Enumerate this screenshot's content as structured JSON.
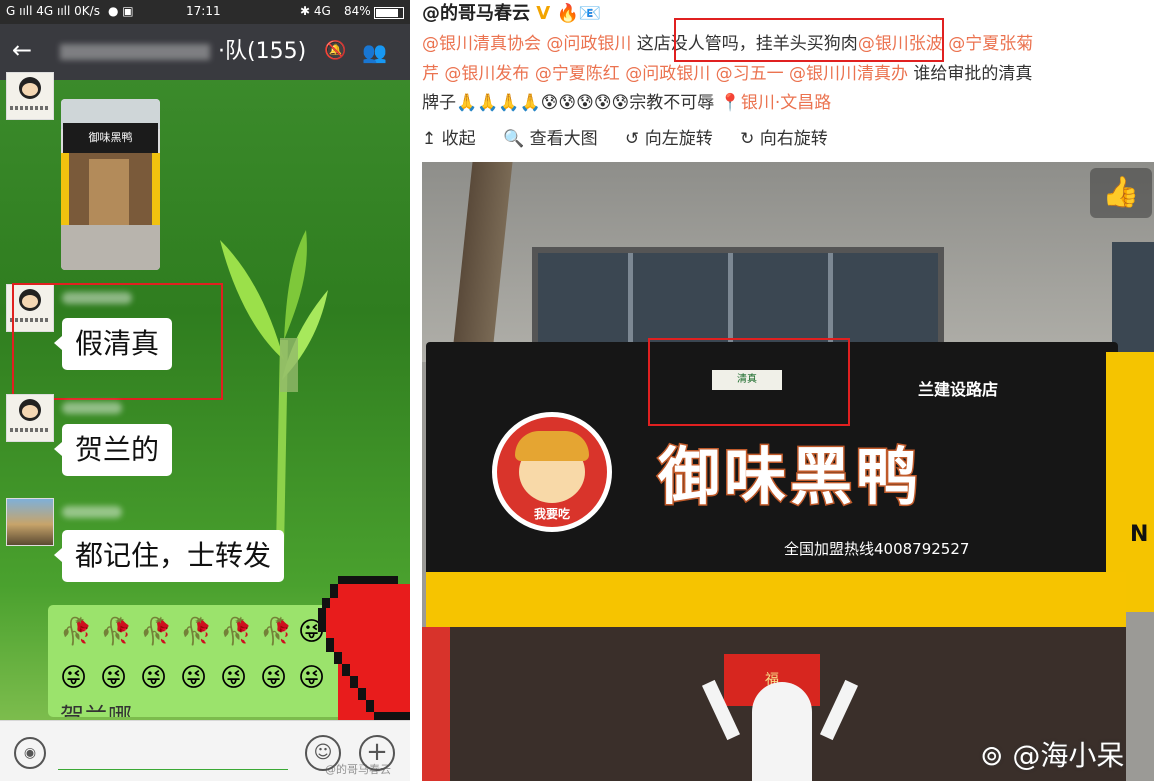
{
  "status_bar": {
    "network_left": "G ııll 4G ııll 0K/s",
    "time": "17:11",
    "battery": "84%"
  },
  "chat": {
    "title": "·队(155)",
    "messages": [
      {
        "type": "image",
        "image_text": "御味黑鸭"
      },
      {
        "type": "text",
        "text": "假清真"
      },
      {
        "type": "text",
        "text": "贺兰的"
      },
      {
        "type": "text",
        "text": "都记住，士转发"
      },
      {
        "type": "emoji",
        "trailing_text": "贺兰哪"
      }
    ],
    "icons": [
      "back-icon",
      "mute-icon",
      "group-members-icon",
      "voice-icon",
      "emoji-icon",
      "plus-icon"
    ],
    "watermark": "@的哥马春云"
  },
  "weibo": {
    "author": "@的哥马春云",
    "lines": [
      {
        "segments": [
          {
            "text": "@银川清真协会",
            "mention": true
          },
          {
            "text": " ",
            "mention": false
          },
          {
            "text": "@问政银川",
            "mention": true
          },
          {
            "text": "  这店没人管吗，挂羊头买狗肉",
            "mention": false
          },
          {
            "text": "@银川张波",
            "mention": true
          },
          {
            "text": " ",
            "mention": false
          },
          {
            "text": "@宁夏张菊",
            "mention": true
          }
        ]
      },
      {
        "segments": [
          {
            "text": "芹 ",
            "mention": true
          },
          {
            "text": "@银川发布",
            "mention": true
          },
          {
            "text": " ",
            "mention": false
          },
          {
            "text": "@宁夏陈红",
            "mention": true
          },
          {
            "text": " ",
            "mention": false
          },
          {
            "text": "@问政银川",
            "mention": true
          },
          {
            "text": " ",
            "mention": false
          },
          {
            "text": "@习五一",
            "mention": true
          },
          {
            "text": " ",
            "mention": false
          },
          {
            "text": "@银川川清真办",
            "mention": true
          },
          {
            "text": " 谁给审批的清真",
            "mention": false
          }
        ]
      },
      {
        "segments": [
          {
            "text": "牌子🙏🙏🙏🙏😰😰😰😰😰宗教不可辱",
            "mention": false
          },
          {
            "text": " 📍银川·文昌路",
            "mention": true
          }
        ]
      }
    ],
    "tools": {
      "collapse": "↥ 收起",
      "view_large": "🔍 查看大图",
      "rotate_left": "↺ 向左旋转",
      "rotate_right": "↻ 向右旋转"
    },
    "photo": {
      "brand": "御味黑鸭",
      "branch": "兰建设路店",
      "hotline": "全国加盟热线4008792527",
      "mascot_text": "我要吃",
      "halal_label": "清真",
      "couplet": "福",
      "n_sign": "N"
    },
    "watermark": "@海小呆"
  }
}
